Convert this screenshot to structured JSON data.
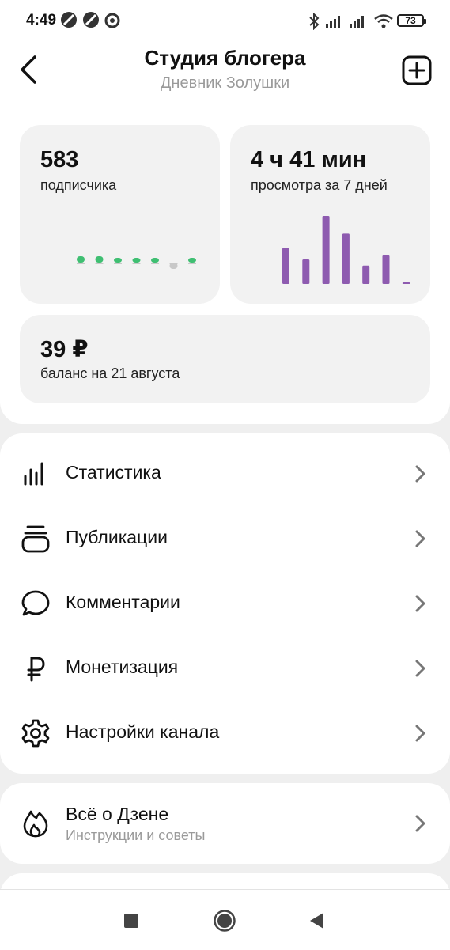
{
  "status_bar": {
    "time": "4:49",
    "battery": "73",
    "icons": [
      "notification-icon",
      "notification-icon",
      "notification-icon",
      "bluetooth-icon",
      "signal-icon",
      "signal-icon",
      "wifi-icon",
      "battery-icon"
    ]
  },
  "header": {
    "title": "Студия блогера",
    "subtitle": "Дневник Золушки",
    "back_icon": "chevron-left-icon",
    "add_icon": "plus-square-icon"
  },
  "stats": {
    "subscribers": {
      "value": "583",
      "label": "подписчика",
      "dots": [
        {
          "level": 1.0,
          "color": "#3fbf72"
        },
        {
          "level": 1.0,
          "color": "#3fbf72"
        },
        {
          "level": 0.5,
          "color": "#3fbf72"
        },
        {
          "level": 0.5,
          "color": "#3fbf72"
        },
        {
          "level": 0.5,
          "color": "#3fbf72"
        },
        {
          "level": -1.0,
          "color": "#c8c8c8"
        },
        {
          "level": 0.5,
          "color": "#3fbf72"
        }
      ]
    },
    "views": {
      "value": "4 ч 41 мин",
      "label": "просмотра за 7 дней",
      "bars": [
        0.53,
        0.36,
        1.0,
        0.74,
        0.27,
        0.42,
        0.02
      ],
      "bar_color": "#8e5bb0"
    },
    "balance": {
      "value": "39 ₽",
      "label": "баланс на 21 августа"
    }
  },
  "menu": [
    {
      "label": "Статистика",
      "icon": "bar-chart-icon"
    },
    {
      "label": "Публикации",
      "icon": "stack-icon"
    },
    {
      "label": "Комментарии",
      "icon": "comment-bubble-icon"
    },
    {
      "label": "Монетизация",
      "icon": "ruble-icon"
    },
    {
      "label": "Настройки канала",
      "icon": "gear-icon"
    }
  ],
  "zen": {
    "title": "Всё о Дзене",
    "subtitle": "Инструкции и советы",
    "icon": "flame-icon"
  },
  "nav": [
    "recents-square-icon",
    "home-circle-icon",
    "back-triangle-icon"
  ],
  "colors": {
    "accent_green": "#3fbf72",
    "accent_purple": "#8e5bb0",
    "muted_text": "#9a9a9a"
  }
}
